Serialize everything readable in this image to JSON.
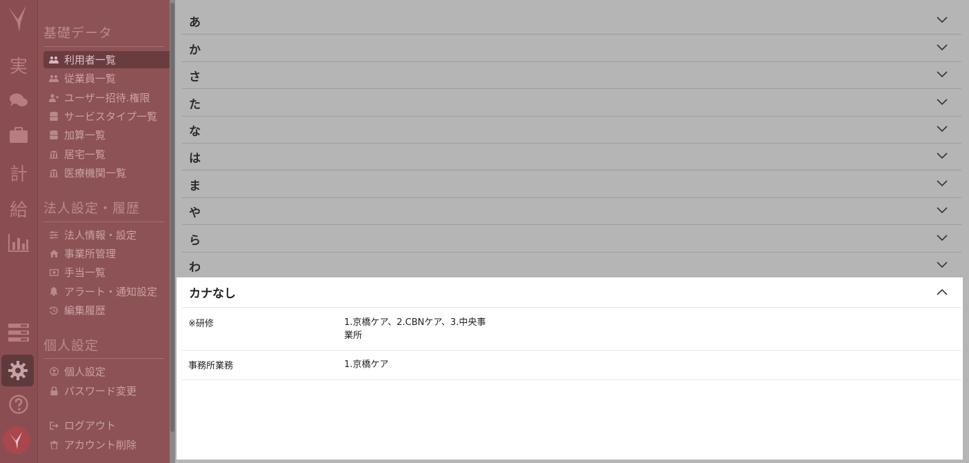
{
  "sidebar": {
    "rail": [
      {
        "name": "jisseki",
        "label": "実"
      },
      {
        "name": "chat"
      },
      {
        "name": "briefcase"
      },
      {
        "name": "keikaku",
        "label": "計"
      },
      {
        "name": "kyuyo",
        "label": "給"
      },
      {
        "name": "chart"
      },
      {
        "name": "list"
      },
      {
        "name": "settings",
        "active": true
      },
      {
        "name": "help"
      }
    ],
    "sections": [
      {
        "title": "基礎データ",
        "items": [
          {
            "label": "利用者一覧",
            "icon": "users-icon",
            "active": true
          },
          {
            "label": "従業員一覧",
            "icon": "users-icon"
          },
          {
            "label": "ユーザー招待.権限",
            "icon": "user-plus-icon"
          },
          {
            "label": "サービスタイプ一覧",
            "icon": "database-icon"
          },
          {
            "label": "加算一覧",
            "icon": "database-icon"
          },
          {
            "label": "居宅一覧",
            "icon": "bank-icon"
          },
          {
            "label": "医療機関一覧",
            "icon": "bank-icon"
          }
        ]
      },
      {
        "title": "法人設定・履歴",
        "items": [
          {
            "label": "法人情報・設定",
            "icon": "sliders-icon"
          },
          {
            "label": "事業所管理",
            "icon": "home-icon"
          },
          {
            "label": "手当一覧",
            "icon": "money-icon"
          },
          {
            "label": "アラート・通知設定",
            "icon": "bell-icon"
          },
          {
            "label": "編集履歴",
            "icon": "history-icon"
          }
        ]
      },
      {
        "title": "個人設定",
        "items": [
          {
            "label": "個人設定",
            "icon": "user-circle-icon"
          },
          {
            "label": "パスワード変更",
            "icon": "lock-icon"
          }
        ]
      }
    ],
    "footer": [
      {
        "label": "ログアウト",
        "icon": "logout-icon"
      },
      {
        "label": "アカウント削除",
        "icon": "trash-icon"
      }
    ]
  },
  "accordion": {
    "rows": [
      "あ",
      "か",
      "さ",
      "た",
      "な",
      "は",
      "ま",
      "や",
      "ら",
      "わ"
    ],
    "open": {
      "title": "カナなし",
      "items": [
        {
          "key": "※研修",
          "value": "1.京橋ケア、2.CBNケア、3.中央事業所"
        },
        {
          "key": "事務所業務",
          "value": "1.京橋ケア"
        }
      ]
    }
  }
}
